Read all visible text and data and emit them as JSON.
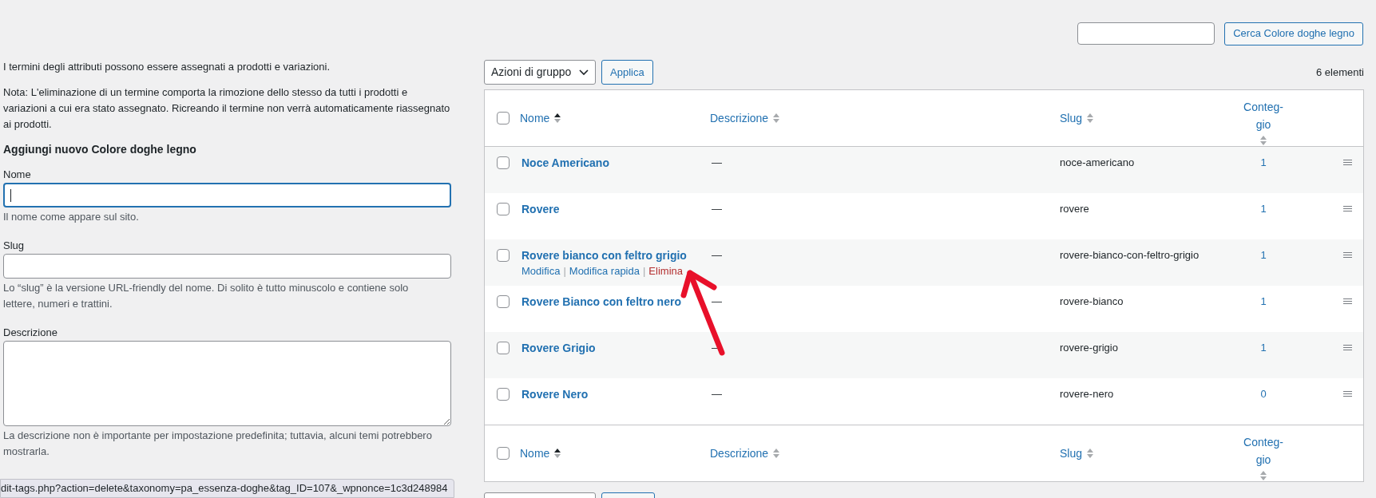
{
  "search": {
    "button": "Cerca Colore doghe legno"
  },
  "intro": "I termini degli attributi possono essere assegnati a prodotti e variazioni.",
  "note": "Nota: L'eliminazione di un termine comporta la rimozione dello stesso da tutti i prodotti e variazioni a cui era stato assegnato. Ricreando il termine non verrà automaticamente riassegnato ai prodotti.",
  "form": {
    "heading": "Aggiungi nuovo Colore doghe legno",
    "fields": [
      {
        "label": "Nome",
        "kind": "input",
        "focused": true,
        "hint": "Il nome come appare sul sito."
      },
      {
        "label": "Slug",
        "kind": "input",
        "focused": false,
        "hint": "Lo “slug” è la versione URL-friendly del nome. Di solito è tutto minuscolo e contiene solo lettere, numeri e trattini."
      },
      {
        "label": "Descrizione",
        "kind": "textarea",
        "focused": false,
        "hint": "La descrizione non è importante per impostazione predefinita; tuttavia, alcuni temi potrebbero mostrarla."
      }
    ]
  },
  "toolbar": {
    "bulk_select": "Azioni di gruppo",
    "apply": "Applica",
    "count": "6 elementi"
  },
  "table": {
    "select_all_checked": false,
    "footer_select_all_checked": false,
    "footer_columns": [
      {
        "label": "Nome",
        "sorted": true
      },
      {
        "label": "Descrizione",
        "sorted": false
      },
      {
        "label": "Slug",
        "sorted": false
      },
      {
        "label": "Conteg-gio",
        "sorted": false
      }
    ],
    "columns": [
      {
        "label": "Nome",
        "sorted": true
      },
      {
        "label": "Descrizione",
        "sorted": false
      },
      {
        "label": "Slug",
        "sorted": false
      },
      {
        "label": "Conteg-gio",
        "sorted": false
      }
    ],
    "rows": [
      {
        "name": "Noce Americano",
        "description": "—",
        "slug": "noce-americano",
        "count": "1",
        "checked": false
      },
      {
        "name": "Rovere",
        "description": "—",
        "slug": "rovere",
        "count": "1",
        "checked": false
      },
      {
        "name": "Rovere bianco con feltro grigio",
        "description": "—",
        "slug": "rovere-bianco-con-feltro-grigio",
        "count": "1",
        "checked": false,
        "actions": [
          {
            "label": "Modifica",
            "kind": "normal"
          },
          {
            "separator": "|",
            "label": "Modifica rapida",
            "kind": "normal"
          },
          {
            "separator": "|",
            "label": "Elimina",
            "kind": "delete"
          }
        ]
      },
      {
        "name": "Rovere Bianco con feltro nero",
        "description": "—",
        "slug": "rovere-bianco",
        "count": "1",
        "checked": false
      },
      {
        "name": "Rovere Grigio",
        "description": "—",
        "slug": "rovere-grigio",
        "count": "1",
        "checked": false
      },
      {
        "name": "Rovere Nero",
        "description": "—",
        "slug": "rovere-nero",
        "count": "0",
        "checked": false
      }
    ]
  },
  "status_bar": "dit-tags.php?action=delete&taxonomy=pa_essenza-doghe&tag_ID=107&_wpnonce=1c3d248984"
}
